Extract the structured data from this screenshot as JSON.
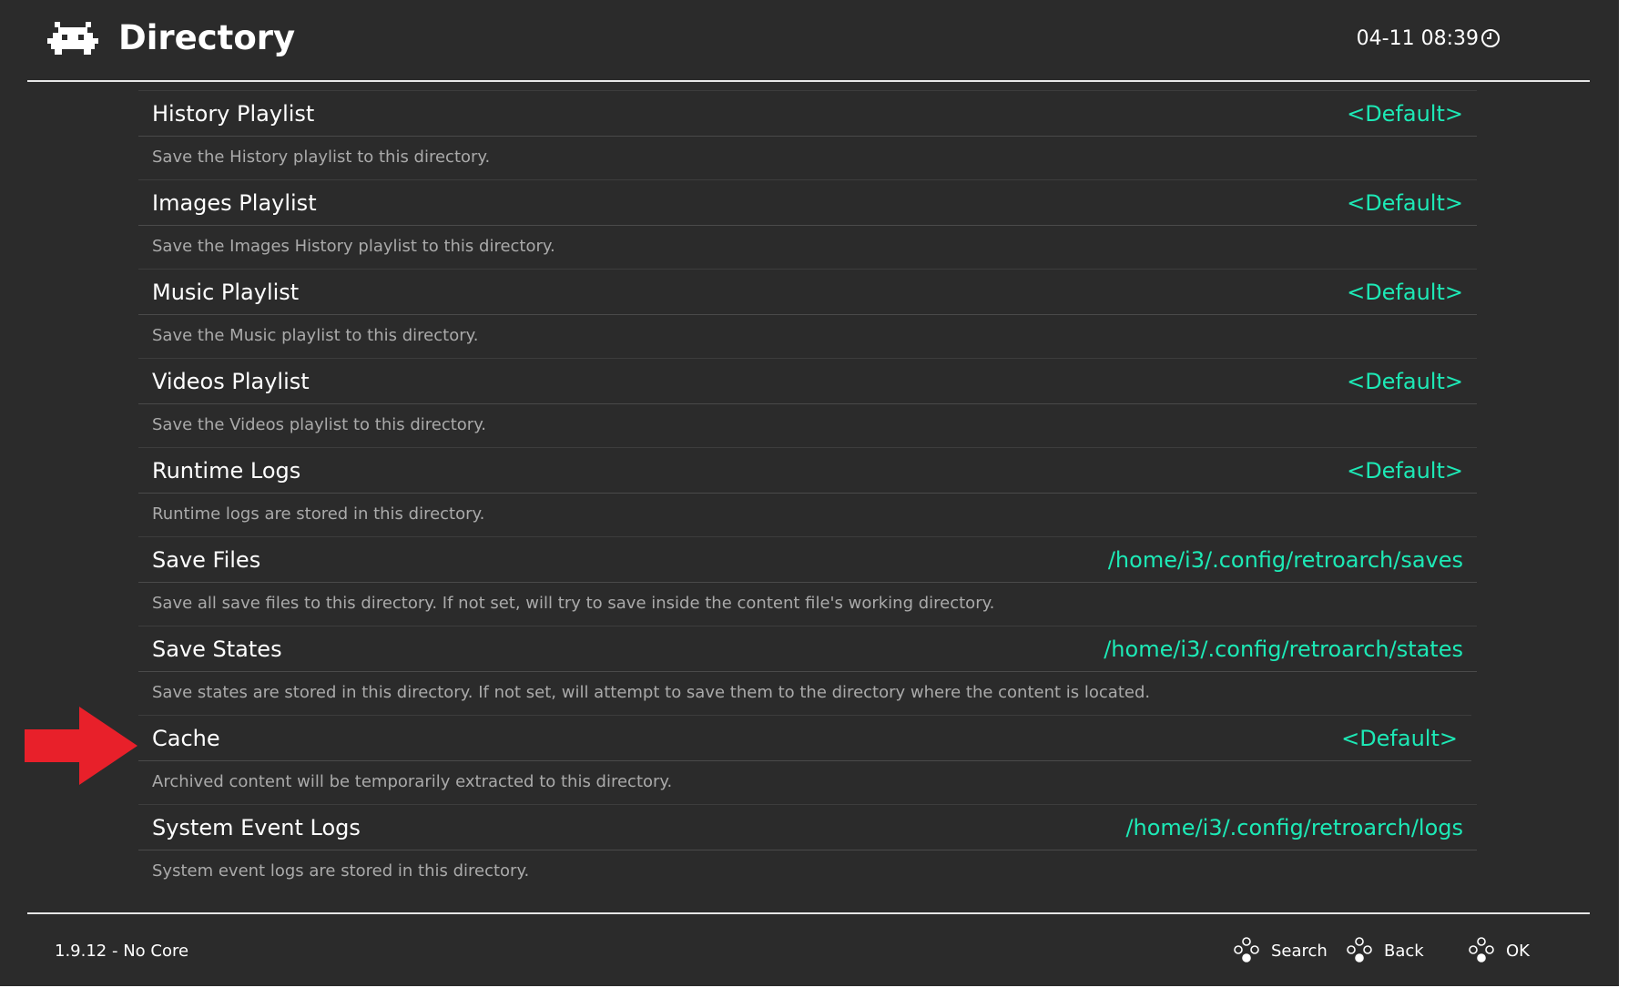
{
  "header": {
    "title": "Directory",
    "clock": "04-11 08:39",
    "logo_icon": "retroarch-invader-icon",
    "clock_icon": "clock-icon"
  },
  "items": [
    {
      "label": "History Playlist",
      "value": "<Default>",
      "desc": "Save the History playlist to this directory."
    },
    {
      "label": "Images Playlist",
      "value": "<Default>",
      "desc": "Save the Images History playlist to this directory."
    },
    {
      "label": "Music Playlist",
      "value": "<Default>",
      "desc": "Save the Music playlist to this directory."
    },
    {
      "label": "Videos Playlist",
      "value": "<Default>",
      "desc": "Save the Videos playlist to this directory."
    },
    {
      "label": "Runtime Logs",
      "value": "<Default>",
      "desc": "Runtime logs are stored in this directory."
    },
    {
      "label": "Save Files",
      "value": "/home/i3/.config/retroarch/saves",
      "desc": "Save all save files to this directory. If not set, will try to save inside the content file's working directory."
    },
    {
      "label": "Save States",
      "value": "/home/i3/.config/retroarch/states",
      "desc": "Save states are stored in this directory. If not set, will attempt to save them to the directory where the content is located."
    },
    {
      "label": "Cache",
      "value": "<Default>",
      "desc": "Archived content will be temporarily extracted to this directory."
    },
    {
      "label": "System Event Logs",
      "value": "/home/i3/.config/retroarch/logs",
      "desc": "System event logs are stored in this directory."
    }
  ],
  "selected_index": 7,
  "footer": {
    "version": "1.9.12 - No Core",
    "hints": [
      {
        "label": "Search",
        "icon": "gamepad-buttons-icon"
      },
      {
        "label": "Back",
        "icon": "gamepad-buttons-icon"
      },
      {
        "label": "OK",
        "icon": "gamepad-buttons-icon"
      }
    ]
  },
  "colors": {
    "background": "#2b2b2b",
    "value_accent": "#1de9b6",
    "annotation_arrow": "#e8202a"
  }
}
